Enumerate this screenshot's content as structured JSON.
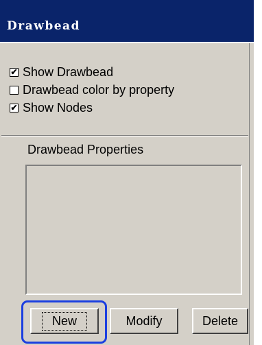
{
  "window": {
    "title": "Drawbead"
  },
  "options": [
    {
      "label": "Show Drawbead",
      "checked": true
    },
    {
      "label": "Drawbead color by property",
      "checked": false
    },
    {
      "label": "Show Nodes",
      "checked": true
    }
  ],
  "properties": {
    "label": "Drawbead Properties",
    "items": []
  },
  "buttons": {
    "new_label": "New",
    "modify_label": "Modify",
    "delete_label": "Delete"
  },
  "colors": {
    "titlebar": "#0a246a",
    "panel": "#d4d0c8",
    "highlight": "#1b3fe0"
  }
}
